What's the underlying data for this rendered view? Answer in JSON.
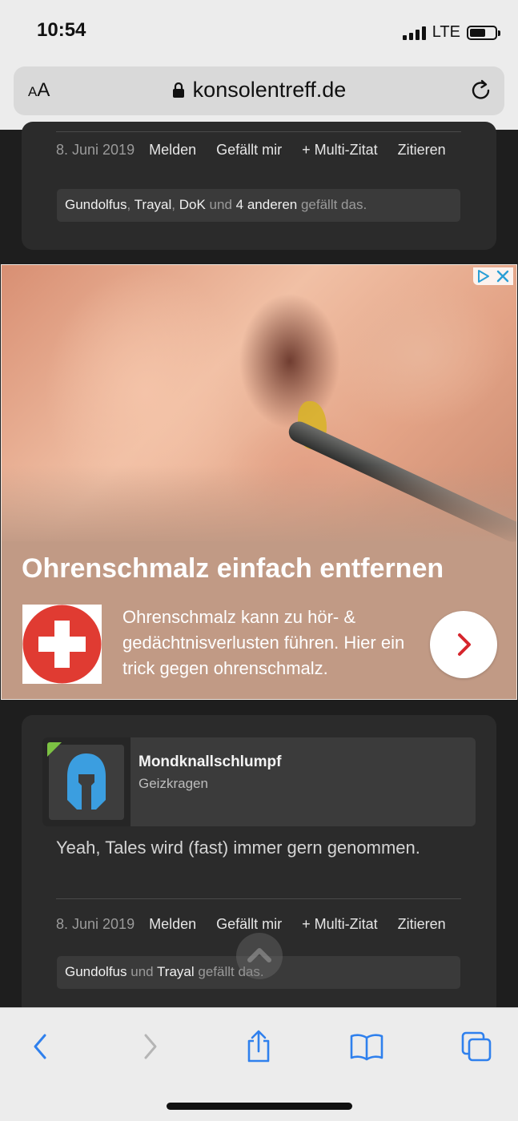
{
  "status_bar": {
    "time": "10:54",
    "network": "LTE"
  },
  "browser": {
    "text_size_label_small": "A",
    "text_size_label_large": "A",
    "url": "konsolentreff.de"
  },
  "posts": [
    {
      "date": "8. Juni 2019",
      "actions": [
        "Melden",
        "Gefällt mir",
        "+ Multi-Zitat",
        "Zitieren"
      ],
      "likes": {
        "users": [
          "Gundolfus",
          "Trayal",
          "DoK"
        ],
        "sep1": ",",
        "sep2": ",",
        "conj": "und",
        "others": "4 anderen",
        "suffix": "gefällt das."
      }
    },
    {
      "author": "Mondknallschlumpf",
      "author_title": "Geizkragen",
      "text": "Yeah, Tales wird (fast) immer gern genommen.",
      "date": "8. Juni 2019",
      "actions": [
        "Melden",
        "Gefällt mir",
        "+ Multi-Zitat",
        "Zitieren"
      ],
      "likes": {
        "users": [
          "Gundolfus",
          "Trayal"
        ],
        "conj": "und",
        "suffix": "gefällt das."
      }
    }
  ],
  "ad": {
    "headline": "Ohrenschmalz einfach entfernen",
    "body": "Ohrenschmalz kann zu hör- & gedächtnisverlusten führen. Hier ein trick gegen ohrenschmalz.",
    "colors": {
      "background": "#c19a85",
      "logo_red": "#e03b32",
      "arrow_red": "#d6262d",
      "adchoices_blue": "#2a9fd6"
    }
  },
  "colors": {
    "online_indicator": "#7cc243",
    "avatar_helmet": "#3b9ee0",
    "toolbar_blue": "#2f80ed"
  }
}
